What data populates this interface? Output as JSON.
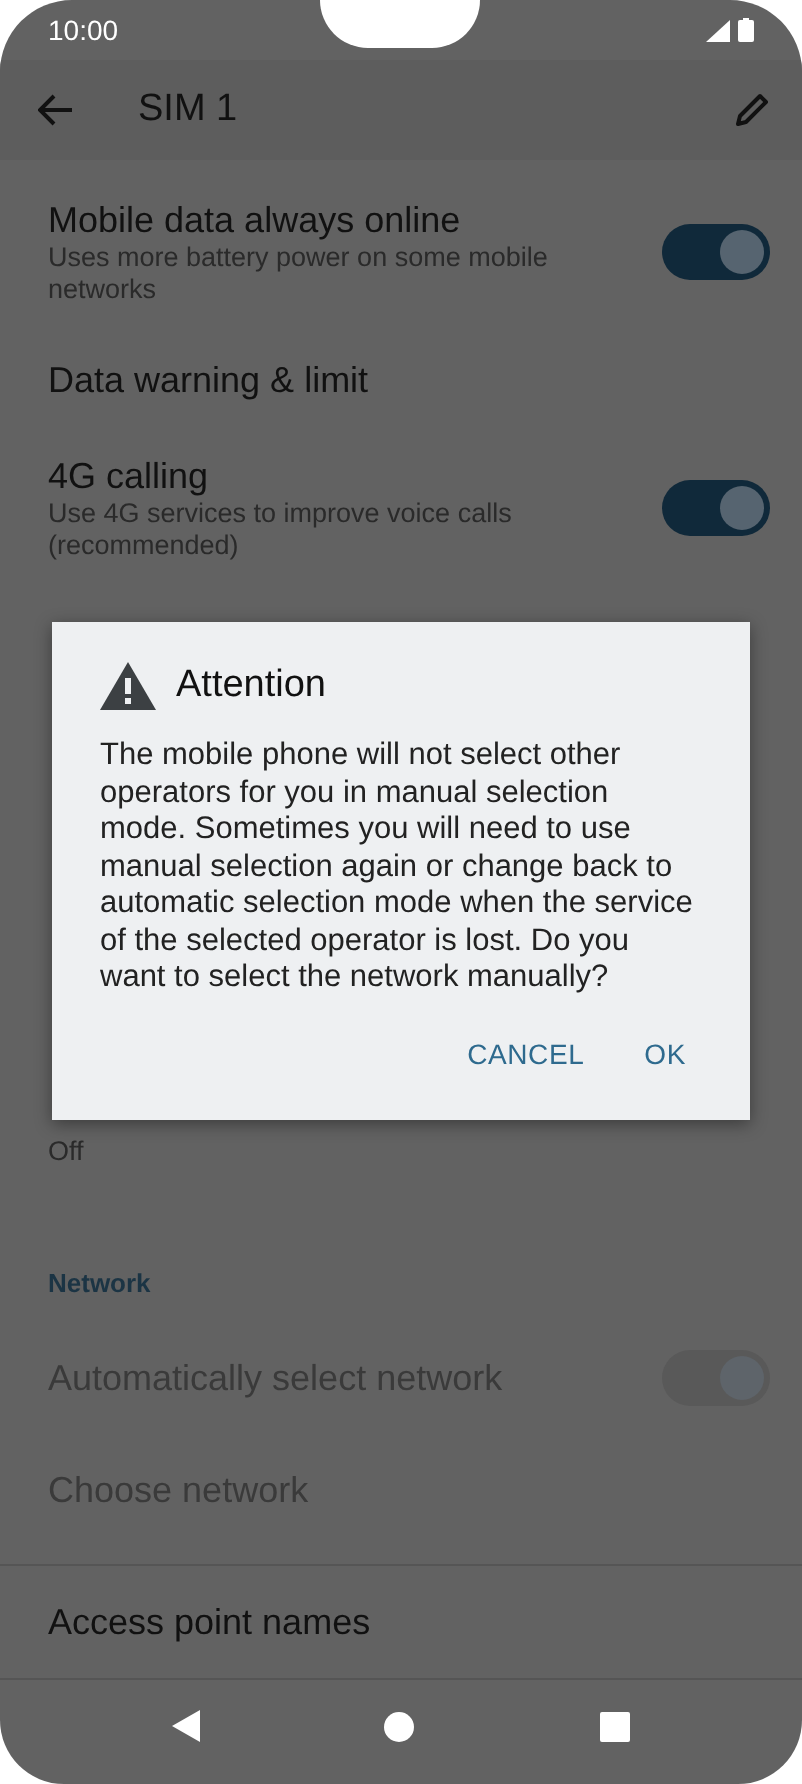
{
  "status_bar": {
    "time": "10:00"
  },
  "toolbar": {
    "title": "SIM 1"
  },
  "settings": [
    {
      "kind": "toggle",
      "title": "Mobile data always online",
      "subtitle": "Uses more battery power on some mobile networks",
      "on": true,
      "disabled": false
    },
    {
      "kind": "plain",
      "title": "Data warning & limit",
      "disabled": false
    },
    {
      "kind": "toggle",
      "title": "4G calling",
      "subtitle": "Use 4G services to improve voice calls (recommended)",
      "on": true,
      "disabled": false
    },
    {
      "kind": "hidden"
    },
    {
      "kind": "plain",
      "subtitle": "Off",
      "disabled": false
    },
    {
      "kind": "header",
      "title": "Network"
    },
    {
      "kind": "toggle",
      "title": "Automatically select network",
      "on": true,
      "disabled": true
    },
    {
      "kind": "plain",
      "title": "Choose network",
      "disabled": true
    },
    {
      "kind": "divided",
      "title": "Access point names",
      "disabled": false
    }
  ],
  "dialog": {
    "title": "Attention",
    "message": "The mobile phone will not select other operators for you in manual selection mode. Sometimes you will need to use manual selection again or change back to automatic selection mode when the service of the selected operator is lost. Do you want to select the network manually?",
    "buttons": [
      "CANCEL",
      "OK"
    ]
  }
}
